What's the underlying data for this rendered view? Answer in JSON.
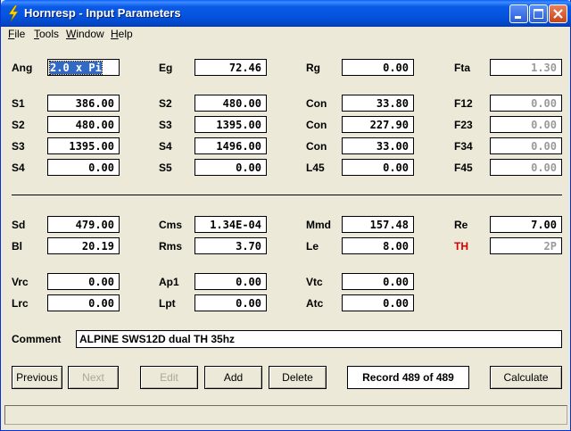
{
  "window": {
    "title": "Hornresp - Input Parameters"
  },
  "menu": [
    "File",
    "Tools",
    "Window",
    "Help"
  ],
  "fields": {
    "ang": {
      "label": "Ang",
      "value": "2.0 x Pi"
    },
    "eg": {
      "label": "Eg",
      "value": "72.46"
    },
    "rg": {
      "label": "Rg",
      "value": "0.00"
    },
    "fta": {
      "label": "Fta",
      "value": "1.30"
    },
    "s1": {
      "label": "S1",
      "value": "386.00"
    },
    "s2a": {
      "label": "S2",
      "value": "480.00"
    },
    "con1": {
      "label": "Con",
      "value": "33.80"
    },
    "f12": {
      "label": "F12",
      "value": "0.00"
    },
    "s2b": {
      "label": "S2",
      "value": "480.00"
    },
    "s3a": {
      "label": "S3",
      "value": "1395.00"
    },
    "con2": {
      "label": "Con",
      "value": "227.90"
    },
    "f23": {
      "label": "F23",
      "value": "0.00"
    },
    "s3b": {
      "label": "S3",
      "value": "1395.00"
    },
    "s4a": {
      "label": "S4",
      "value": "1496.00"
    },
    "con3": {
      "label": "Con",
      "value": "33.00"
    },
    "f34": {
      "label": "F34",
      "value": "0.00"
    },
    "s4b": {
      "label": "S4",
      "value": "0.00"
    },
    "s5": {
      "label": "S5",
      "value": "0.00"
    },
    "l45": {
      "label": "L45",
      "value": "0.00"
    },
    "f45": {
      "label": "F45",
      "value": "0.00"
    },
    "sd": {
      "label": "Sd",
      "value": "479.00"
    },
    "cms": {
      "label": "Cms",
      "value": "1.34E-04"
    },
    "mmd": {
      "label": "Mmd",
      "value": "157.48"
    },
    "re": {
      "label": "Re",
      "value": "7.00"
    },
    "bl": {
      "label": "Bl",
      "value": "20.19"
    },
    "rms": {
      "label": "Rms",
      "value": "3.70"
    },
    "le": {
      "label": "Le",
      "value": "8.00"
    },
    "th": {
      "label": "TH",
      "value": "2P"
    },
    "vrc": {
      "label": "Vrc",
      "value": "0.00"
    },
    "ap1": {
      "label": "Ap1",
      "value": "0.00"
    },
    "vtc": {
      "label": "Vtc",
      "value": "0.00"
    },
    "lrc": {
      "label": "Lrc",
      "value": "0.00"
    },
    "lpt": {
      "label": "Lpt",
      "value": "0.00"
    },
    "atc": {
      "label": "Atc",
      "value": "0.00"
    }
  },
  "comment": {
    "label": "Comment",
    "value": "ALPINE SWS12D dual TH 35hz"
  },
  "buttons": {
    "previous": "Previous",
    "next": "Next",
    "edit": "Edit",
    "add": "Add",
    "delete": "Delete",
    "calculate": "Calculate"
  },
  "record": "Record 489 of 489",
  "colors": {
    "title_bar": "#0454e0",
    "th_label": "#d40000",
    "selection": "#316ac5"
  }
}
